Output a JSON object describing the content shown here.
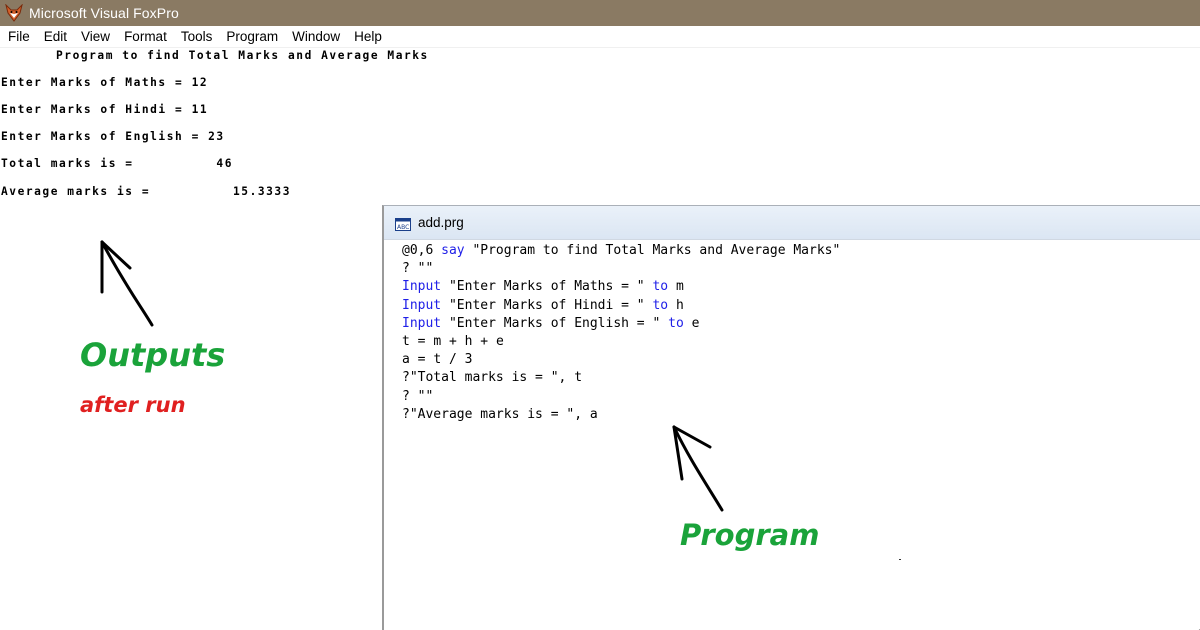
{
  "window": {
    "title": "Microsoft Visual FoxPro",
    "icon": "foxpro-fox-icon",
    "title_bar_color": "#8a7a63"
  },
  "menu": {
    "items": [
      "File",
      "Edit",
      "View",
      "Format",
      "Tools",
      "Program",
      "Window",
      "Help"
    ]
  },
  "output": {
    "heading": "Program to find Total Marks and Average Marks",
    "lines": [
      "Enter Marks of Maths = 12",
      "Enter Marks of Hindi = 11",
      "Enter Marks of English = 23",
      "Total marks is =          46",
      "Average marks is =          15.3333"
    ]
  },
  "annotations": {
    "outputs_label": "Outputs",
    "after_run_label": "after run",
    "program_label": "Program",
    "outputs_color": "#1aa33a",
    "after_run_color": "#e02020",
    "program_color": "#1aa33a"
  },
  "editor": {
    "filename": "add.prg",
    "icon": "program-file-icon",
    "keyword_color": "#2020e8",
    "code": [
      "@0,6 say \"Program to find Total Marks and Average Marks\"",
      "? \"\"",
      "Input \"Enter Marks of Maths = \" to m",
      "Input \"Enter Marks of Hindi = \" to h",
      "Input \"Enter Marks of English = \" to e",
      "t = m + h + e",
      "a = t / 3",
      "?\"Total marks is = \", t",
      "? \"\"",
      "?\"Average marks is = \", a"
    ],
    "caret_line": 9
  }
}
